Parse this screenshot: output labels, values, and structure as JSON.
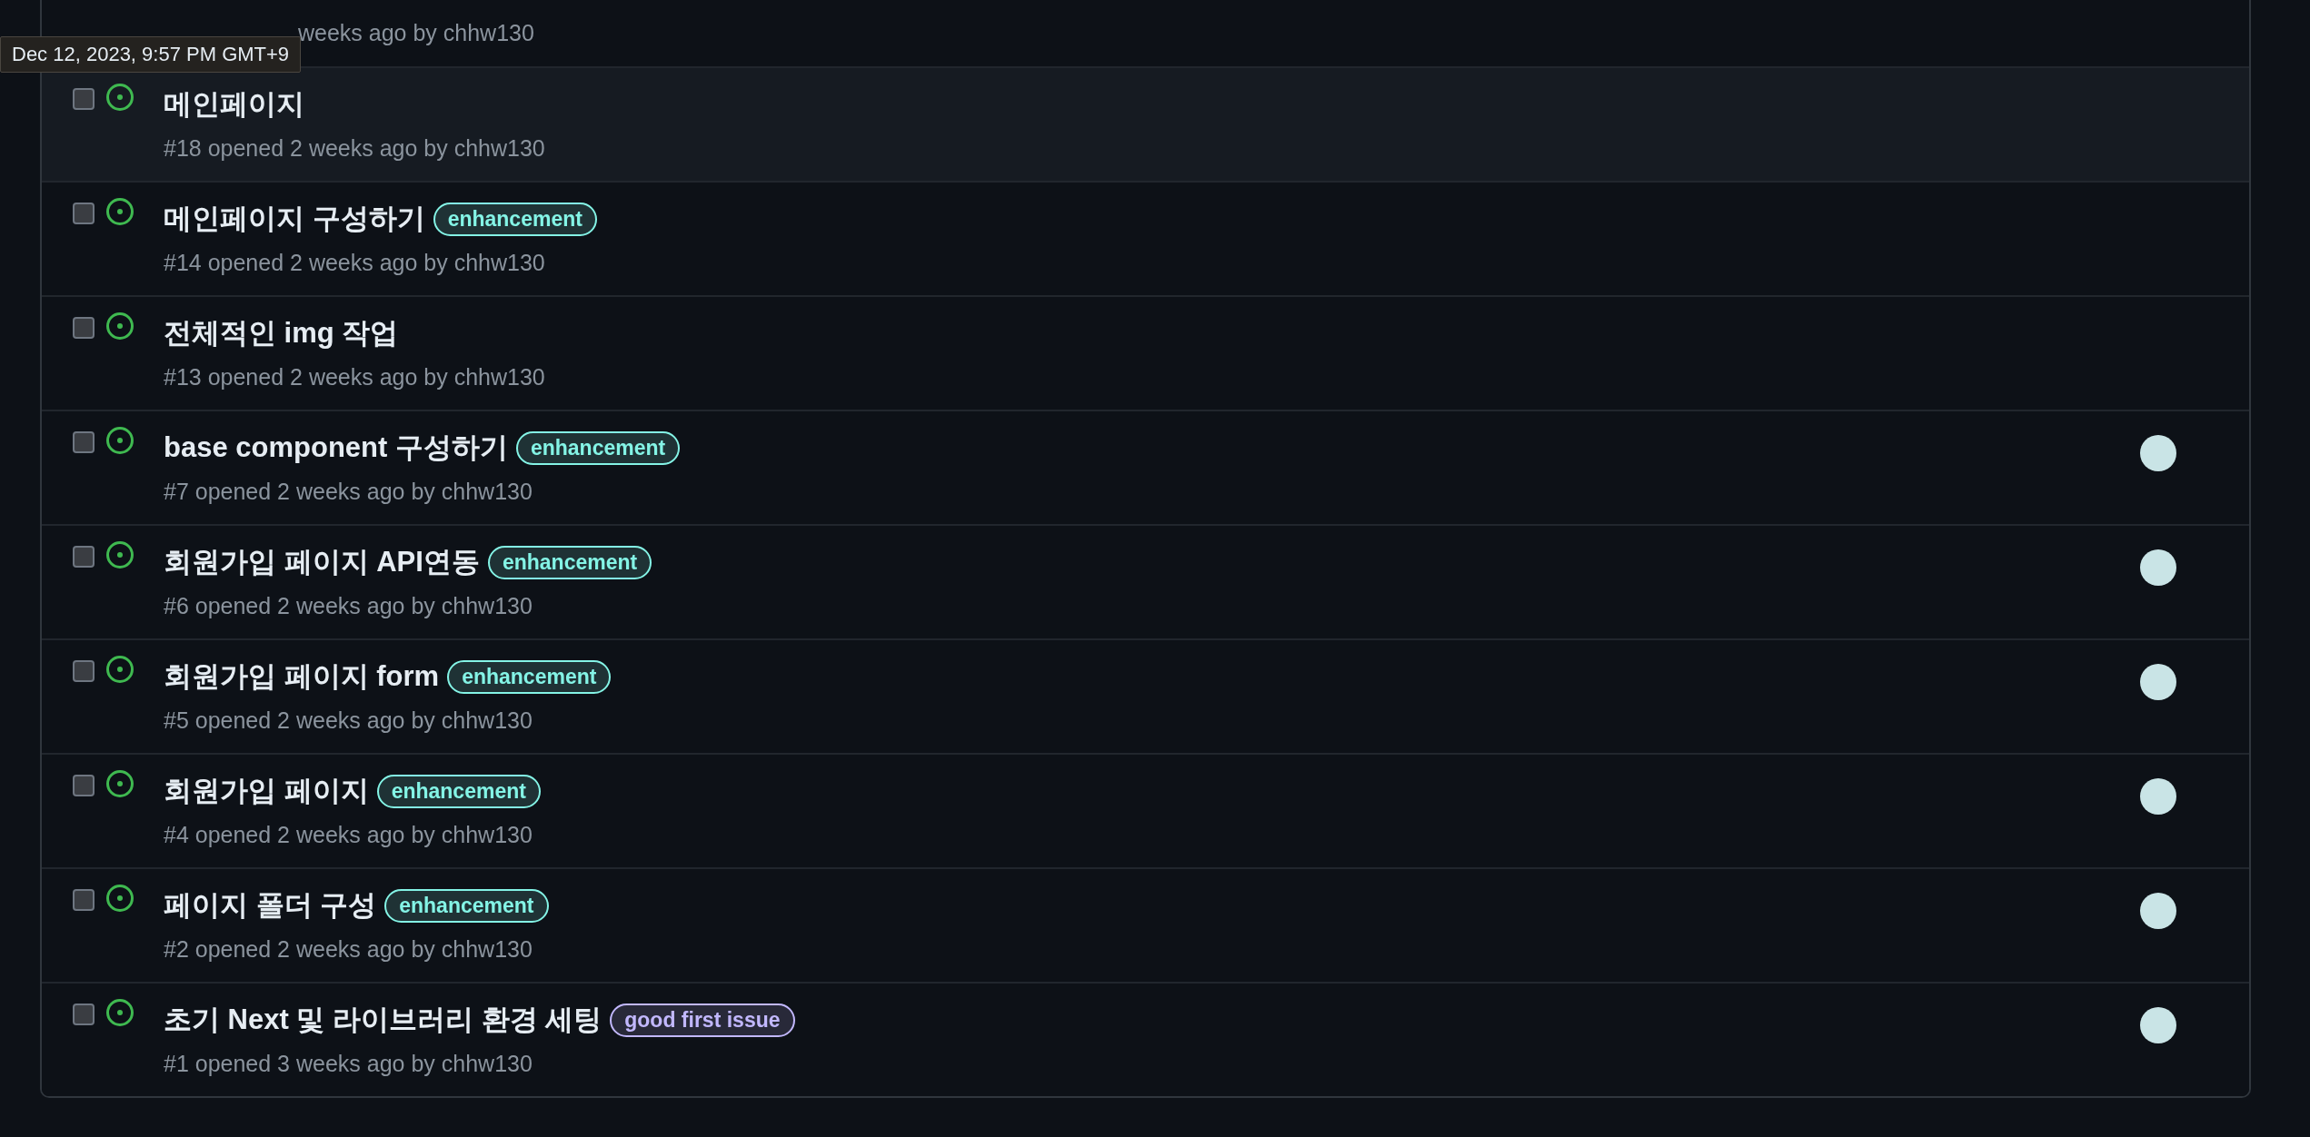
{
  "tooltip": "Dec 12, 2023, 9:57 PM GMT+9",
  "issues": [
    {
      "kind": "partial",
      "meta": "weeks ago by chhw130"
    },
    {
      "title": "메인페이지",
      "meta": "#18 opened 2 weeks ago by chhw130",
      "hovered": true,
      "checked": false,
      "assignee": false
    },
    {
      "title": "메인페이지 구성하기",
      "labels": [
        {
          "text": "enhancement",
          "color": "#84f4e6"
        }
      ],
      "meta": "#14 opened 2 weeks ago by chhw130",
      "hovered": false,
      "checked": false,
      "assignee": false
    },
    {
      "title": "전체적인 img 작업",
      "meta": "#13 opened 2 weeks ago by chhw130",
      "hovered": false,
      "checked": false,
      "assignee": false
    },
    {
      "title": "base component 구성하기",
      "labels": [
        {
          "text": "enhancement",
          "color": "#84f4e6"
        }
      ],
      "meta": "#7 opened 2 weeks ago by chhw130",
      "hovered": false,
      "checked": false,
      "assignee": true
    },
    {
      "title": "회원가입 페이지 API연동",
      "labels": [
        {
          "text": "enhancement",
          "color": "#84f4e6"
        }
      ],
      "meta": "#6 opened 2 weeks ago by chhw130",
      "hovered": false,
      "checked": false,
      "assignee": true
    },
    {
      "title": "회원가입 페이지 form",
      "labels": [
        {
          "text": "enhancement",
          "color": "#84f4e6"
        }
      ],
      "meta": "#5 opened 2 weeks ago by chhw130",
      "hovered": false,
      "checked": false,
      "assignee": true
    },
    {
      "title": "회원가입 페이지",
      "labels": [
        {
          "text": "enhancement",
          "color": "#84f4e6"
        }
      ],
      "meta": "#4 opened 2 weeks ago by chhw130",
      "hovered": false,
      "checked": false,
      "assignee": true
    },
    {
      "title": "페이지 폴더 구성",
      "labels": [
        {
          "text": "enhancement",
          "color": "#84f4e6"
        }
      ],
      "meta": "#2 opened 2 weeks ago by chhw130",
      "hovered": false,
      "checked": false,
      "assignee": true
    },
    {
      "title": "초기 Next 및 라이브러리 환경 세팅",
      "labels": [
        {
          "text": "good first issue",
          "color": "#c2b8ff"
        }
      ],
      "meta": "#1 opened 3 weeks ago by chhw130",
      "hovered": false,
      "checked": false,
      "assignee": true
    }
  ]
}
